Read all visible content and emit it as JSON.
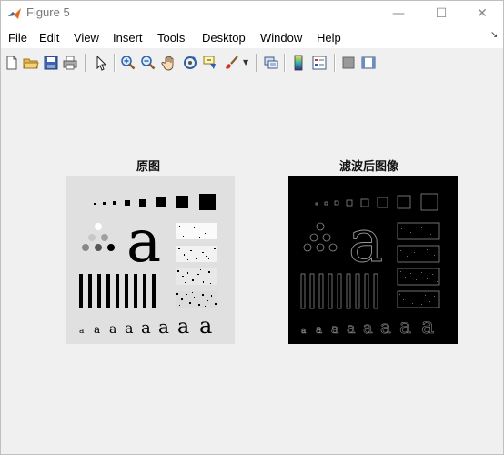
{
  "window": {
    "title": "Figure 5",
    "minimize_glyph": "—",
    "maximize_glyph": "☐",
    "close_glyph": "✕"
  },
  "menu": {
    "items": [
      "File",
      "Edit",
      "View",
      "Insert",
      "Tools",
      "Desktop",
      "Window",
      "Help"
    ],
    "dock_glyph": "↘"
  },
  "toolbar": {
    "icons": [
      "new-figure-icon",
      "open-file-icon",
      "save-icon",
      "print-icon",
      "pointer-icon",
      "zoom-in-icon",
      "zoom-out-icon",
      "pan-icon",
      "rotate-3d-icon",
      "data-cursor-icon",
      "brush-icon",
      "brush-dropdown-icon",
      "link-plot-icon",
      "colorbar-icon",
      "legend-icon",
      "hide-plot-tools-icon",
      "show-plot-tools-icon"
    ]
  },
  "axes": [
    {
      "title": "原图",
      "image": "original-test-pattern"
    },
    {
      "title": "滤波后图像",
      "image": "filtered-edge-image"
    }
  ],
  "pattern": {
    "letter": "a"
  }
}
